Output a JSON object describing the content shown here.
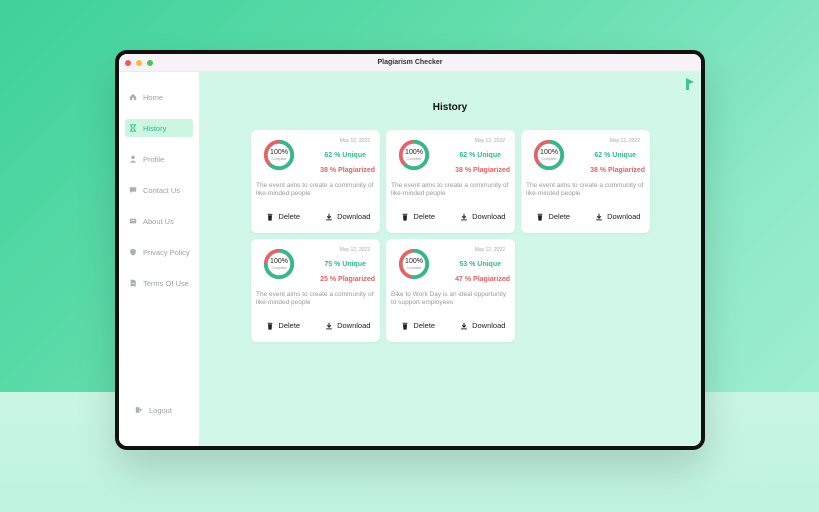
{
  "window": {
    "title": "Plagiarism Checker"
  },
  "colors": {
    "accent": "#2dbb84",
    "unique": "#34b98a",
    "plagiarized": "#e06468"
  },
  "sidebar": {
    "items": [
      {
        "label": "Home",
        "icon": "home-icon",
        "active": false
      },
      {
        "label": "History",
        "icon": "history-icon",
        "active": true
      },
      {
        "label": "Profile",
        "icon": "user-icon",
        "active": false
      },
      {
        "label": "Contact Us",
        "icon": "chat-icon",
        "active": false
      },
      {
        "label": "About Us",
        "icon": "info-icon",
        "active": false
      },
      {
        "label": "Privacy Policy",
        "icon": "shield-icon",
        "active": false
      },
      {
        "label": "Terms Of Use",
        "icon": "document-icon",
        "active": false
      }
    ],
    "logout": "Logout"
  },
  "main": {
    "heading": "History"
  },
  "cards": [
    {
      "date": "May 12, 2022",
      "percent": "100%",
      "percent_sub": "Complete",
      "unique_text": "62 % Unique",
      "plag_text": "38 % Plagiarized",
      "unique": 62,
      "desc": "The event aims to create a community of like-minded people",
      "delete_label": "Delete",
      "download_label": "Download"
    },
    {
      "date": "May 12, 2022",
      "percent": "100%",
      "percent_sub": "Complete",
      "unique_text": "62 % Unique",
      "plag_text": "38 % Plagiarized",
      "unique": 62,
      "desc": "The event aims to create a community of like-minded people",
      "delete_label": "Delete",
      "download_label": "Download"
    },
    {
      "date": "May 12, 2022",
      "percent": "100%",
      "percent_sub": "Complete",
      "unique_text": "62 % Unique",
      "plag_text": "38 % Plagiarized",
      "unique": 62,
      "desc": "The event aims to create a community of like-minded people",
      "delete_label": "Delete",
      "download_label": "Download"
    },
    {
      "date": "May 12, 2022",
      "percent": "100%",
      "percent_sub": "Complete",
      "unique_text": "75 % Unique",
      "plag_text": "25 % Plagiarized",
      "unique": 75,
      "desc": "The event aims to create a community of like-minded people",
      "delete_label": "Delete",
      "download_label": "Download"
    },
    {
      "date": "May 12, 2022",
      "percent": "100%",
      "percent_sub": "Complete",
      "unique_text": "53 % Unique",
      "plag_text": "47 % Plagiarized",
      "unique": 53,
      "desc": "Bike to Work Day is an ideal opportunity to support employees",
      "delete_label": "Delete",
      "download_label": "Download"
    }
  ]
}
